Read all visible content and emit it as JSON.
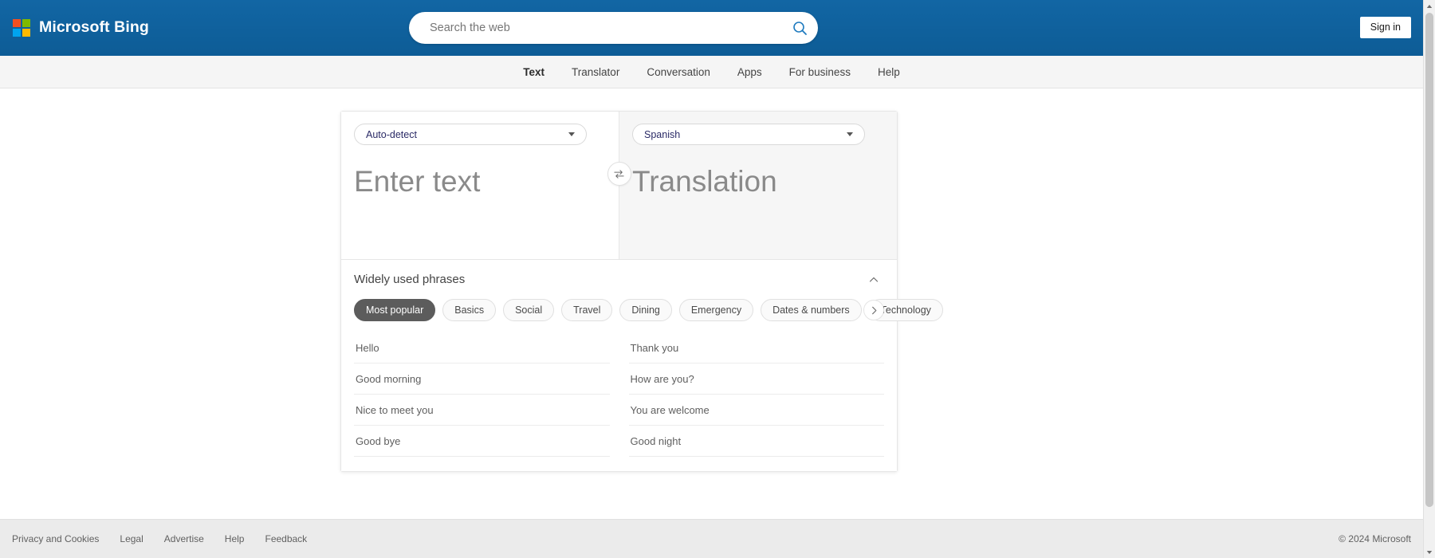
{
  "header": {
    "brand_name": "Microsoft Bing",
    "logo_icon": "microsoft-logo-icon",
    "search": {
      "placeholder": "Search the web",
      "value": "",
      "icon": "search-icon"
    },
    "signin_label": "Sign in",
    "background_color": "#10659f"
  },
  "nav": {
    "items": [
      {
        "label": "Text",
        "active": true
      },
      {
        "label": "Translator",
        "active": false
      },
      {
        "label": "Conversation",
        "active": false
      },
      {
        "label": "Apps",
        "active": false
      },
      {
        "label": "For business",
        "active": false
      },
      {
        "label": "Help",
        "active": false
      }
    ]
  },
  "translator": {
    "source": {
      "language": "Auto-detect",
      "placeholder": "Enter text",
      "value": "",
      "caret_icon": "chevron-down-icon"
    },
    "target": {
      "language": "Spanish",
      "placeholder": "Translation",
      "value": "",
      "caret_icon": "chevron-down-icon"
    },
    "swap_icon": "swap-arrows-icon"
  },
  "phrases": {
    "title": "Widely used phrases",
    "collapse_icon": "chevron-up-icon",
    "next_icon": "chevron-right-icon",
    "selected_category": "Most popular",
    "categories": [
      {
        "label": "Most popular",
        "selected": true
      },
      {
        "label": "Basics",
        "selected": false
      },
      {
        "label": "Social",
        "selected": false
      },
      {
        "label": "Travel",
        "selected": false
      },
      {
        "label": "Dining",
        "selected": false
      },
      {
        "label": "Emergency",
        "selected": false
      },
      {
        "label": "Dates & numbers",
        "selected": false
      },
      {
        "label": "Technology",
        "selected": false
      }
    ],
    "items": [
      "Hello",
      "Thank you",
      "Good morning",
      "How are you?",
      "Nice to meet you",
      "You are welcome",
      "Good bye",
      "Good night"
    ]
  },
  "footer": {
    "links": [
      "Privacy and Cookies",
      "Legal",
      "Advertise",
      "Help",
      "Feedback"
    ],
    "copyright": "© 2024 Microsoft"
  }
}
